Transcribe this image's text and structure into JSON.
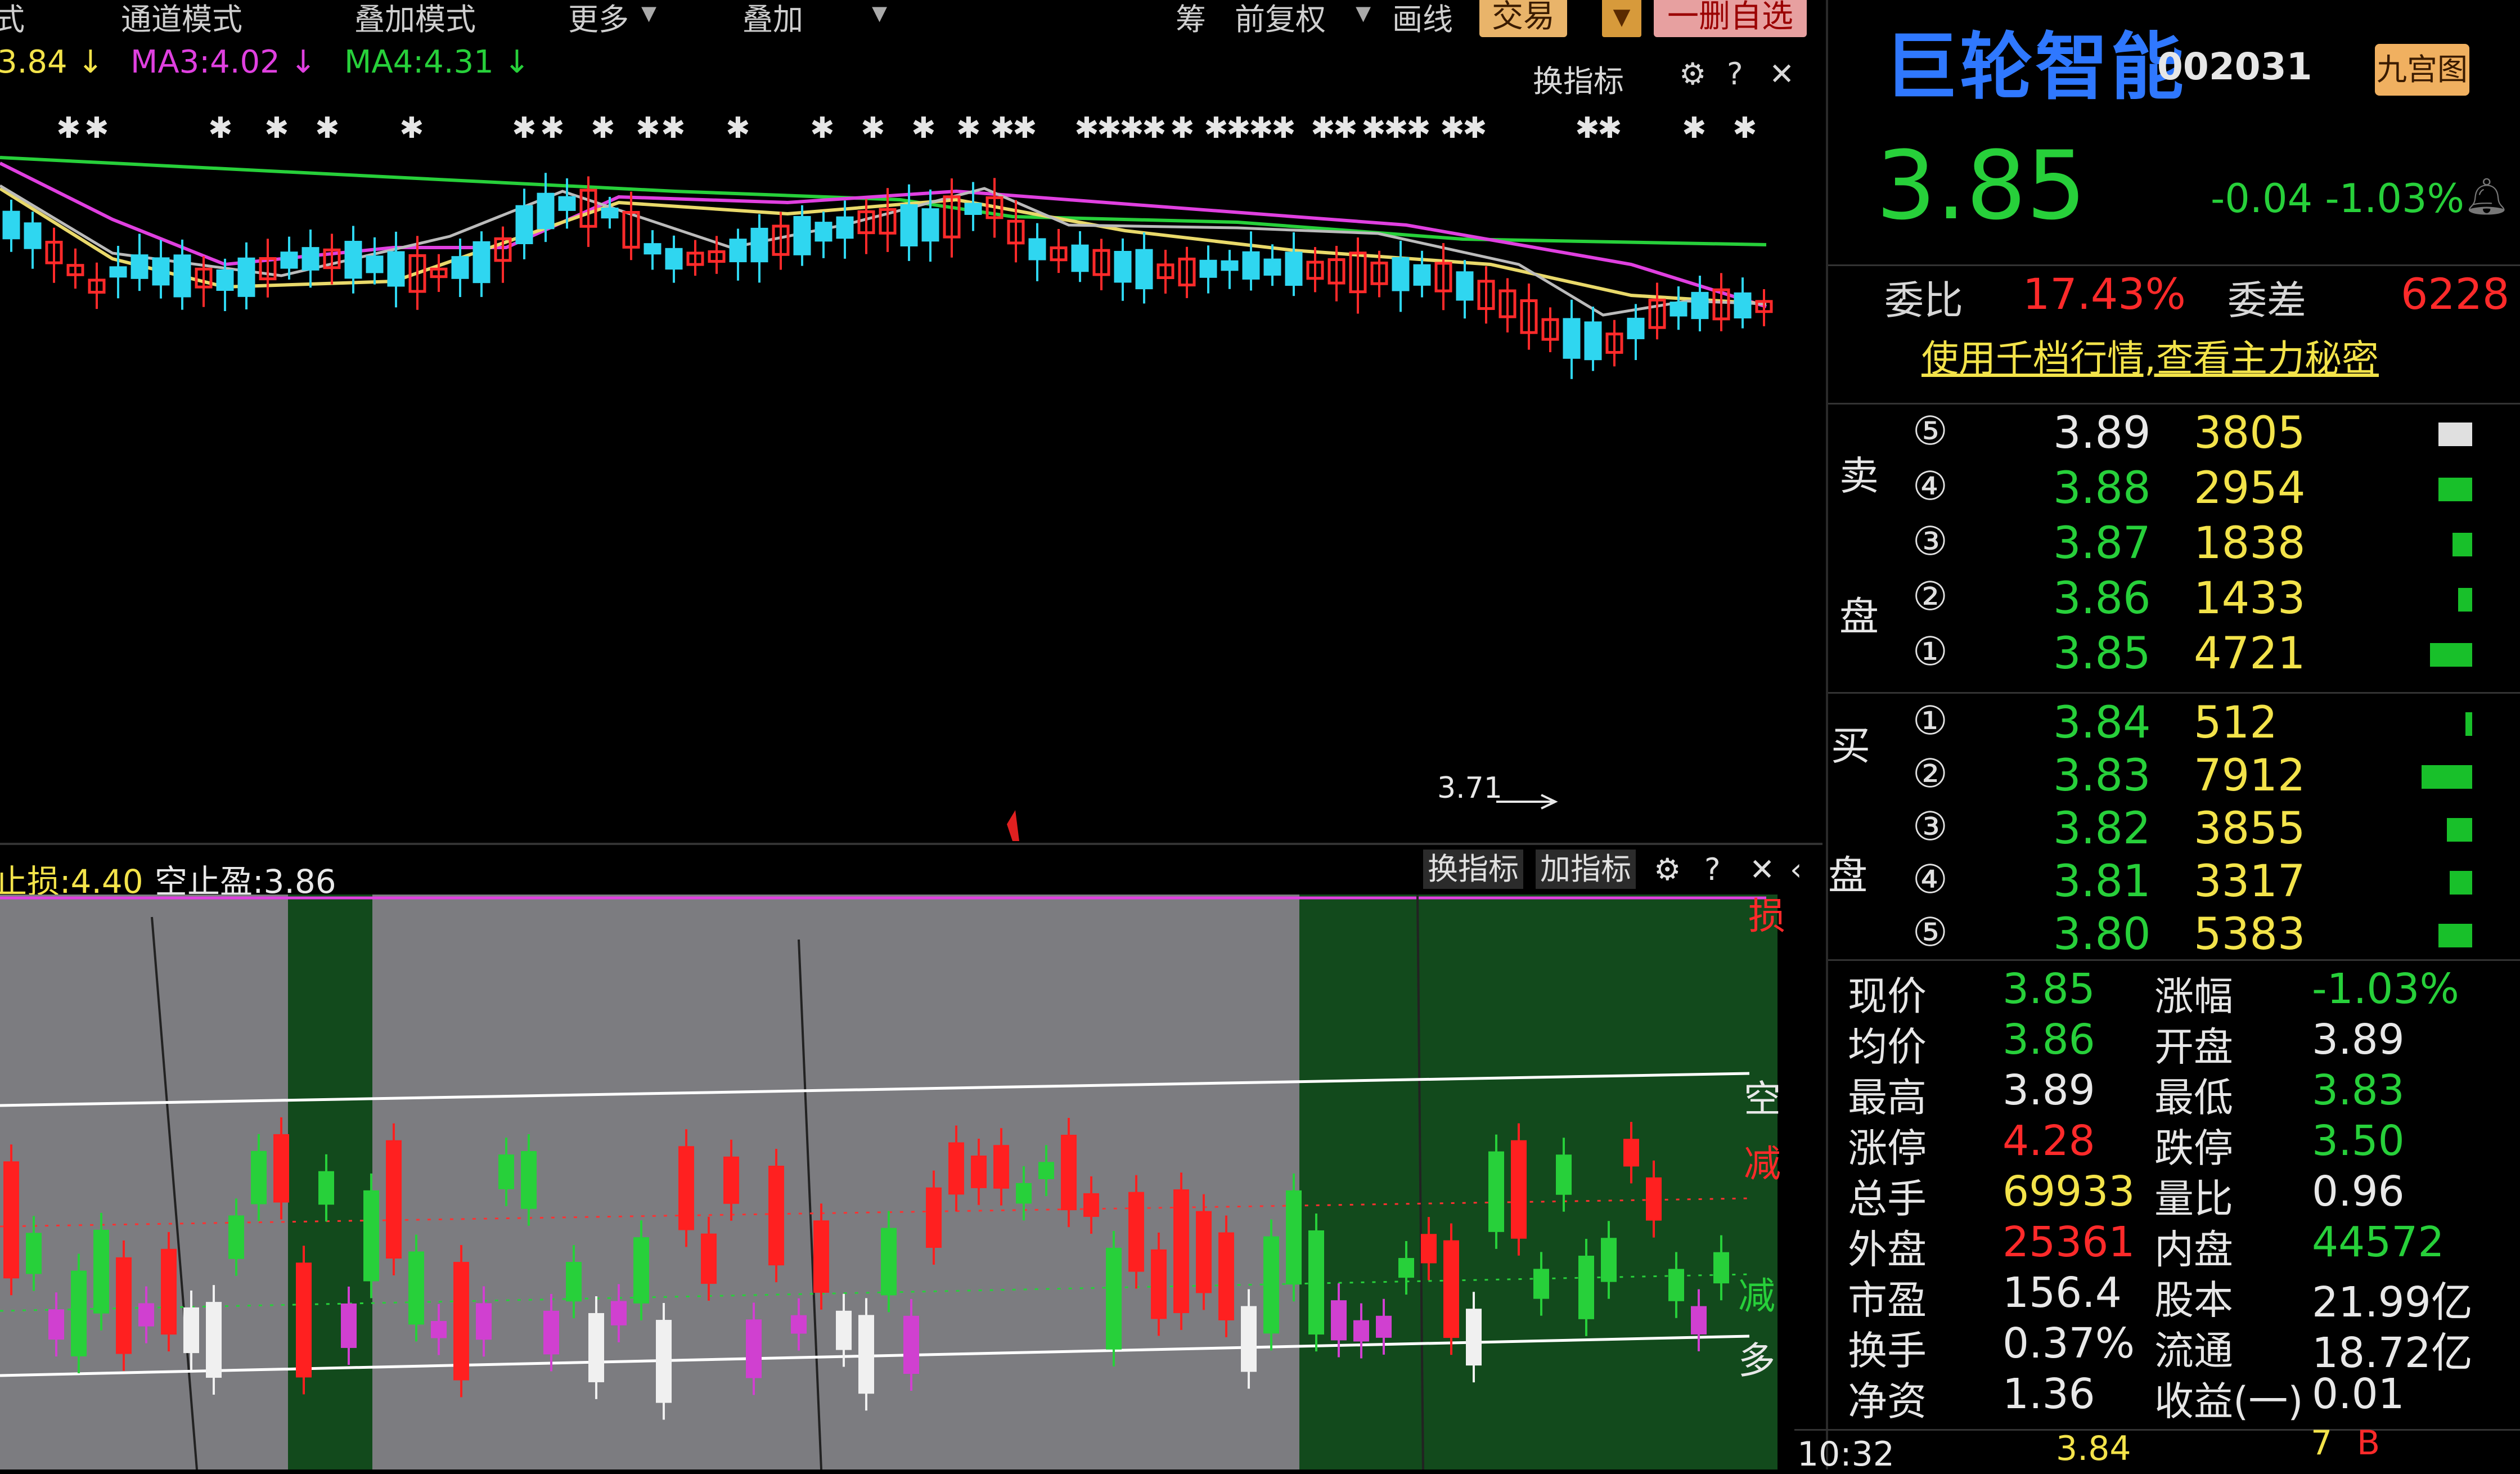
{
  "menu": {
    "items": [
      "式",
      "通道模式",
      "叠加模式",
      "更多",
      "叠加"
    ],
    "right_items": [
      "筹",
      "前复权",
      "画线"
    ],
    "trade_label": "交易",
    "remove_label": "一删自选"
  },
  "ma_legend": {
    "ma2": "3.84",
    "ma3": "MA3:4.02",
    "ma4": "MA4:4.31"
  },
  "main_toolbar": {
    "switch_label": "换指标"
  },
  "chart_annotations": {
    "low_label": "3.71"
  },
  "sub_header": {
    "stop_loss": "止损:4.40",
    "short_stop": "空止盈:3.86",
    "switch_label": "换指标",
    "add_label": "加指标"
  },
  "sub_side_labels": [
    "损",
    "空",
    "减",
    "减",
    "多"
  ],
  "colors": {
    "up": "#ff2a2a",
    "down": "#27d03a",
    "accent_blue": "#2f78ff",
    "yellow": "#f3e34a"
  },
  "quote": {
    "name": "巨轮智能",
    "code": "002031",
    "nine_button": "九宫图",
    "price": "3.85",
    "change": "-0.04",
    "change_pct": "-1.03%",
    "commission_ratio_label": "委比",
    "commission_ratio": "17.43%",
    "commission_diff_label": "委差",
    "commission_diff": "6228",
    "promo": "使用千档行情,查看主力秘密"
  },
  "orderbook": {
    "sell_label": [
      "卖",
      "盘"
    ],
    "buy_label": [
      "买",
      "盘"
    ],
    "sell": [
      {
        "n": "⑤",
        "price": "3.89",
        "vol": "3805",
        "bar": 0.12
      },
      {
        "n": "④",
        "price": "3.88",
        "vol": "2954",
        "bar": 0.12
      },
      {
        "n": "③",
        "price": "3.87",
        "vol": "1838",
        "bar": 0.07
      },
      {
        "n": "②",
        "price": "3.86",
        "vol": "1433",
        "bar": 0.05
      },
      {
        "n": "①",
        "price": "3.85",
        "vol": "4721",
        "bar": 0.15
      }
    ],
    "buy": [
      {
        "n": "①",
        "price": "3.84",
        "vol": "512",
        "bar": 0.02
      },
      {
        "n": "②",
        "price": "3.83",
        "vol": "7912",
        "bar": 0.18
      },
      {
        "n": "③",
        "price": "3.82",
        "vol": "3855",
        "bar": 0.09
      },
      {
        "n": "④",
        "price": "3.81",
        "vol": "3317",
        "bar": 0.08
      },
      {
        "n": "⑤",
        "price": "3.80",
        "vol": "5383",
        "bar": 0.12
      }
    ]
  },
  "stats": [
    {
      "l1": "现价",
      "v1": "3.85",
      "c1": "green",
      "l2": "涨幅",
      "v2": "-1.03%",
      "c2": "green"
    },
    {
      "l1": "均价",
      "v1": "3.86",
      "c1": "green",
      "l2": "开盘",
      "v2": "3.89",
      "c2": "white"
    },
    {
      "l1": "最高",
      "v1": "3.89",
      "c1": "white",
      "l2": "最低",
      "v2": "3.83",
      "c2": "green"
    },
    {
      "l1": "涨停",
      "v1": "4.28",
      "c1": "red",
      "l2": "跌停",
      "v2": "3.50",
      "c2": "green"
    },
    {
      "l1": "总手",
      "v1": "69933",
      "c1": "yellow",
      "l2": "量比",
      "v2": "0.96",
      "c2": "white"
    },
    {
      "l1": "外盘",
      "v1": "25361",
      "c1": "red",
      "l2": "内盘",
      "v2": "44572",
      "c2": "green"
    },
    {
      "l1": "市盈",
      "v1": "156.4",
      "c1": "white",
      "l2": "股本",
      "v2": "21.99亿",
      "c2": "white"
    },
    {
      "l1": "换手",
      "v1": "0.37%",
      "c1": "white",
      "l2": "流通",
      "v2": "18.72亿",
      "c2": "white"
    },
    {
      "l1": "净资",
      "v1": "1.36",
      "c1": "white",
      "l2": "收益(一)",
      "v2": "0.01",
      "c2": "white"
    }
  ],
  "tick": {
    "time": "10:32",
    "price": "3.84",
    "vol": "7",
    "side": "B"
  }
}
